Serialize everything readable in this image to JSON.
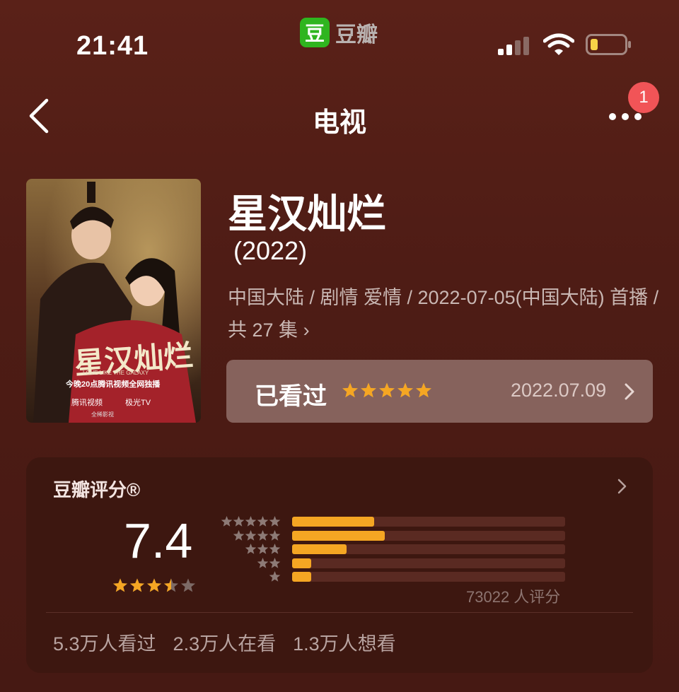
{
  "status_bar": {
    "time": "21:41",
    "app_logo_char": "豆",
    "app_name": "豆瓣",
    "battery_color": "#f6d348",
    "icons": [
      "signal-icon",
      "wifi-icon",
      "battery-icon"
    ]
  },
  "nav": {
    "title": "电视",
    "back_icon": "chevron-left-icon",
    "more_icon": "ellipsis-icon",
    "badge_count": "1"
  },
  "poster": {
    "title_art": "星汉灿烂",
    "subtitle": "LOVE LIKE THE GALAXY",
    "promo": "今晚20点腾讯视频全网独播",
    "brand_1": "腾讯视频",
    "brand_2": "极光TV",
    "bottom_text": "全稀影视"
  },
  "show": {
    "title": "星汉灿烂",
    "year": "(2022)",
    "meta": "中国大陆 / 剧情 爱情 / 2022-07-05(中国大陆) 首播 / 共 27 集",
    "meta_chevron": "›"
  },
  "watched": {
    "label": "已看过",
    "stars": 5,
    "date": "2022.07.09",
    "star_color": "#f5a623"
  },
  "rating": {
    "title": "豆瓣评分®",
    "score": "7.4",
    "stars": 3.5,
    "distribution": [
      {
        "stars": 5,
        "fraction": 0.3
      },
      {
        "stars": 4,
        "fraction": 0.34
      },
      {
        "stars": 3,
        "fraction": 0.2
      },
      {
        "stars": 2,
        "fraction": 0.07
      },
      {
        "stars": 1,
        "fraction": 0.07
      }
    ],
    "count_text": "73022 人评分",
    "accent": "#f5a623",
    "stats": [
      "5.3万人看过",
      "2.3万人在看",
      "1.3万人想看"
    ]
  }
}
